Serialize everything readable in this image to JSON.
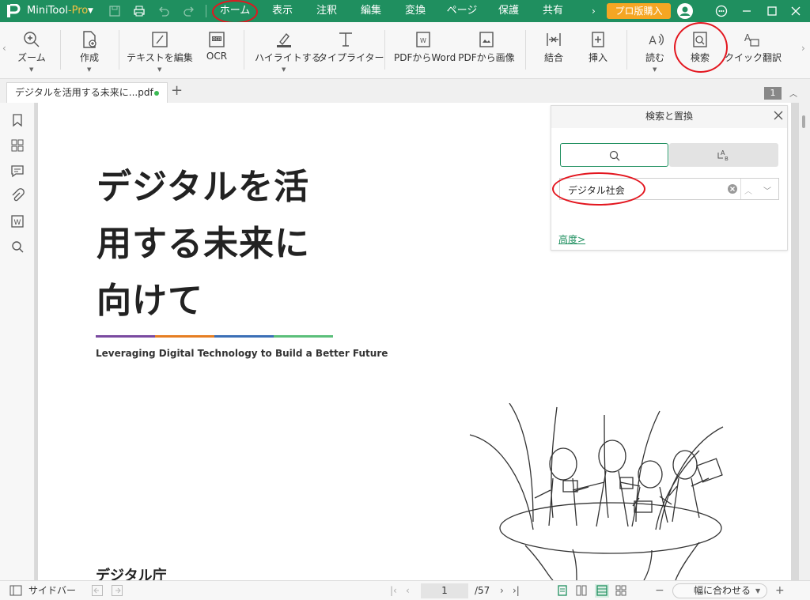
{
  "app": {
    "name": "MiniTool",
    "edition": "-Pro"
  },
  "menu": [
    "ホーム",
    "表示",
    "注釈",
    "編集",
    "変換",
    "ページ",
    "保護",
    "共有"
  ],
  "buy_label": "プロ版購入",
  "toolbar": {
    "zoom": "ズーム",
    "create": "作成",
    "edit_text": "テキストを編集",
    "ocr": "OCR",
    "highlight": "ハイライトする",
    "typewriter": "タイプライター",
    "pdf_to_word": "PDFからWord",
    "pdf_to_image": "PDFから画像",
    "merge": "結合",
    "insert": "挿入",
    "read": "読む",
    "search": "検索",
    "quick_translate": "クイック翻訳"
  },
  "tab": {
    "filename": "デジタルを活用する未来に...pdf",
    "page_badge": "1"
  },
  "document": {
    "title_lines": [
      "デジタルを活",
      "用する未来に",
      "向けて"
    ],
    "subtitle": "Leveraging Digital Technology to Build a Better Future",
    "org": "デジタル庁",
    "rule_colors": [
      "#7a4aa0",
      "#e67e22",
      "#3b6fb6",
      "#5bbf7a"
    ]
  },
  "search_panel": {
    "title": "検索と置換",
    "query": "デジタル社会",
    "advanced": "高度>"
  },
  "statusbar": {
    "sidebar_label": "サイドバー",
    "current_page": "1",
    "total_pages": "/57",
    "fit_width": "幅に合わせる"
  },
  "colors": {
    "accent": "#1f8f5f",
    "buy": "#f5a623",
    "highlight_circle": "#e3161f"
  }
}
